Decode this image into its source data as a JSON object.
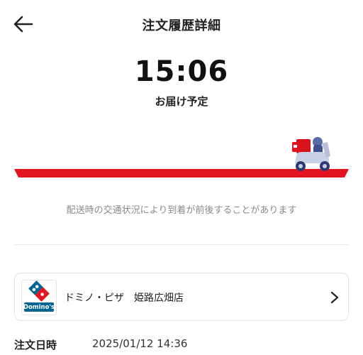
{
  "header": {
    "title": "注文履歴詳細",
    "back_icon": "arrow-left-icon"
  },
  "delivery": {
    "eta_time": "15:06",
    "eta_label": "お届け予定",
    "progress_fraction": 0.89,
    "progress_color": "#e3141f",
    "notice": "配送時の交通状況により到着が前後することがあります"
  },
  "store": {
    "name": "ドミノ・ピザ　姫路広畑店",
    "logo_text": "Domino's",
    "chevron_icon": "chevron-right-icon"
  },
  "order": {
    "date_label": "注文日時",
    "date_value": "2025/01/12 14:36"
  },
  "colors": {
    "accent_red": "#e3141f",
    "domino_blue": "#006491",
    "text_gray": "#8a8a8a"
  }
}
